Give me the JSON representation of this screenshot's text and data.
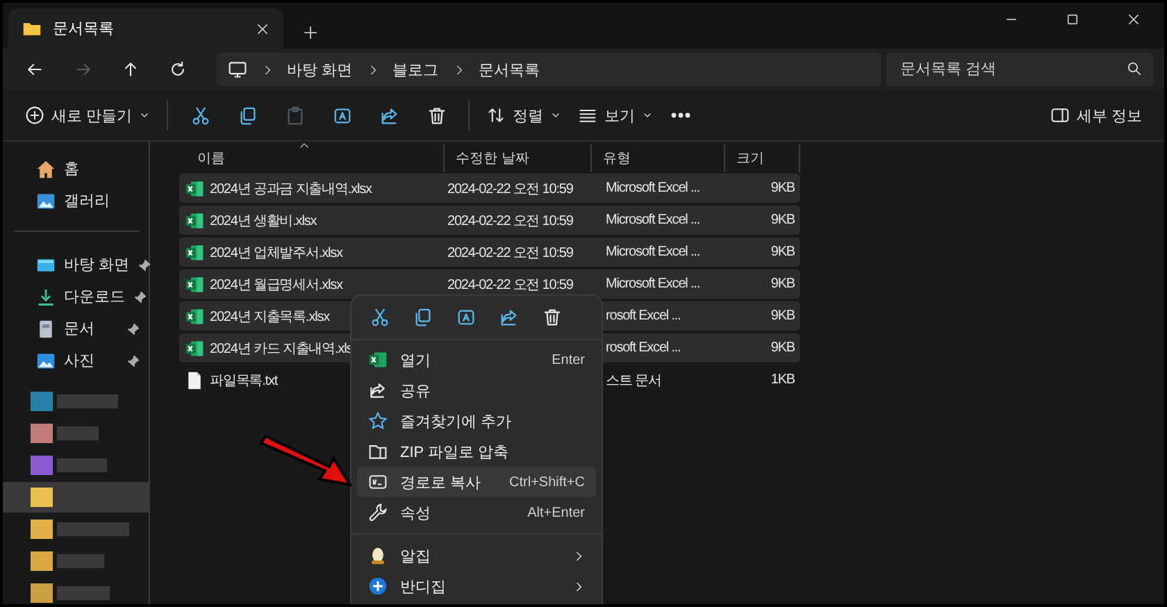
{
  "window": {
    "tab": {
      "title": "문서목록",
      "selected": true
    }
  },
  "navigation": {
    "buttons": [
      {
        "disabled": false
      },
      {
        "disabled": true
      },
      {
        "disabled": false
      },
      {
        "disabled": false
      }
    ],
    "breadcrumbs": [
      "바탕 화면",
      "블로그",
      "문서목록"
    ],
    "search": {
      "placeholder": "문서목록 검색"
    }
  },
  "toolbar": {
    "new": {
      "label": "새로 만들기"
    },
    "actions": [
      {
        "disabled": false
      },
      {
        "disabled": false
      },
      {
        "disabled": true
      },
      {
        "disabled": false
      },
      {
        "disabled": false
      },
      {
        "disabled": false
      }
    ],
    "sort": {
      "label": "정렬"
    },
    "view": {
      "label": "보기"
    },
    "details": {
      "label": "세부 정보"
    }
  },
  "sidebar": {
    "items": [
      {
        "label": "홈",
        "pinned": false
      },
      {
        "label": "갤러리",
        "pinned": false
      }
    ],
    "quick_access": [
      {
        "label": "바탕 화면",
        "pinned": true
      },
      {
        "label": "다운로드",
        "pinned": true
      },
      {
        "label": "문서",
        "pinned": true
      },
      {
        "label": "사진",
        "pinned": true
      }
    ],
    "blurred_items": [
      {
        "selected": false
      },
      {
        "selected": false
      },
      {
        "selected": false
      },
      {
        "selected": true
      },
      {
        "selected": false
      },
      {
        "selected": false
      },
      {
        "selected": false
      }
    ]
  },
  "file_list": {
    "columns": [
      {
        "label": "이름",
        "sorted": true
      },
      {
        "label": "수정한 날짜",
        "sorted": false
      },
      {
        "label": "유형",
        "sorted": false
      },
      {
        "label": "크기",
        "sorted": false
      }
    ],
    "rows": [
      {
        "kind": "excel",
        "name": "2024년 공과금 지출내역.xlsx",
        "date": "2024-02-22 오전 10:59",
        "type": "Microsoft Excel ...",
        "size": "9KB",
        "selected": true
      },
      {
        "kind": "excel",
        "name": "2024년 생활비.xlsx",
        "date": "2024-02-22 오전 10:59",
        "type": "Microsoft Excel ...",
        "size": "9KB",
        "selected": true
      },
      {
        "kind": "excel",
        "name": "2024년 업체발주서.xlsx",
        "date": "2024-02-22 오전 10:59",
        "type": "Microsoft Excel ...",
        "size": "9KB",
        "selected": true
      },
      {
        "kind": "excel",
        "name": "2024년 월급명세서.xlsx",
        "date": "2024-02-22 오전 10:59",
        "type": "Microsoft Excel ...",
        "size": "9KB",
        "selected": true
      },
      {
        "kind": "excel",
        "name": "2024년 지출목록.xlsx",
        "type": "rosoft Excel ...",
        "size": "9KB",
        "selected": true
      },
      {
        "kind": "excel",
        "name": "2024년 카드 지출내역.xls",
        "type": "rosoft Excel ...",
        "size": "9KB",
        "selected": true
      },
      {
        "kind": "text",
        "name": "파일목록.txt",
        "type": "스트 문서",
        "size": "1KB",
        "selected": false
      }
    ]
  },
  "context_menu": {
    "items": [
      {
        "label": "열기",
        "shortcut": "Enter",
        "selected": false,
        "submenu": false
      },
      {
        "label": "공유",
        "selected": false,
        "submenu": false
      },
      {
        "label": "즐겨찾기에 추가",
        "selected": false,
        "submenu": false
      },
      {
        "label": "ZIP 파일로 압축",
        "selected": false,
        "submenu": false
      },
      {
        "label": "경로로 복사",
        "shortcut": "Ctrl+Shift+C",
        "selected": true,
        "submenu": false
      },
      {
        "label": "속성",
        "shortcut": "Alt+Enter",
        "selected": false,
        "submenu": false
      },
      {
        "label": "알집",
        "selected": false,
        "submenu": true,
        "separator_before": true
      },
      {
        "label": "반디집",
        "selected": false,
        "submenu": true,
        "separator_before": false
      }
    ]
  }
}
